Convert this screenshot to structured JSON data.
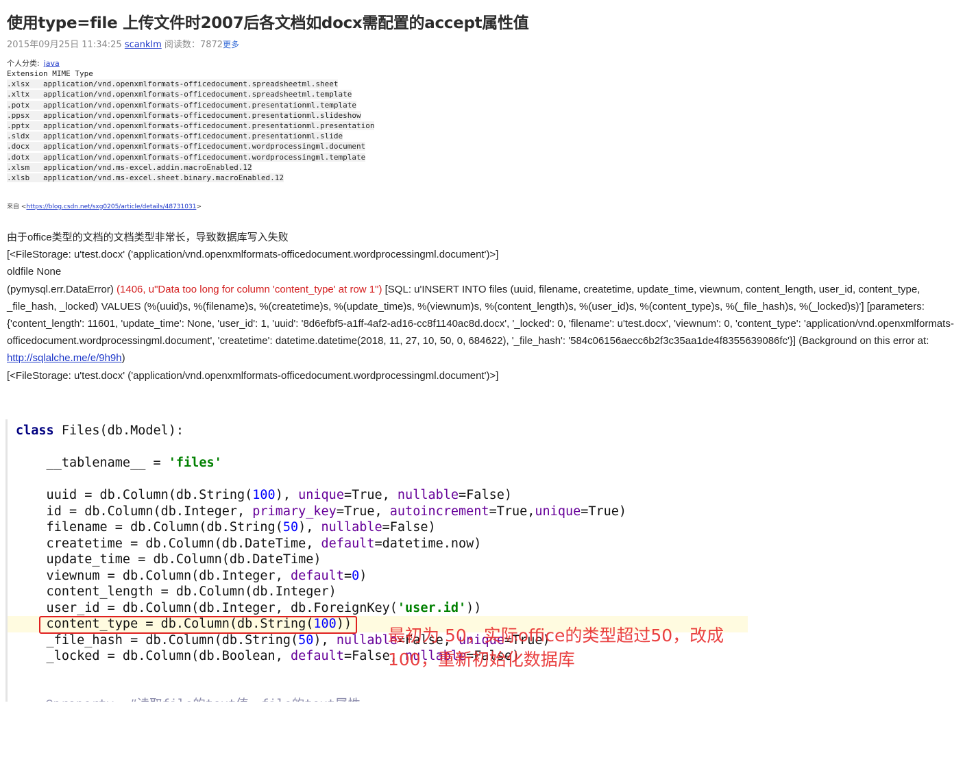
{
  "article": {
    "title": "使用type=file 上传文件时2007后各文档如docx需配置的accept属性值",
    "date": "2015年09月25日 11:34:25",
    "author": "scanklm",
    "reads_label": "阅读数：",
    "reads": "7872",
    "more": "更多",
    "category_label": "个人分类:",
    "category": "java"
  },
  "mime_table": {
    "header": "Extension MIME Type",
    "rows": [
      {
        "ext": ".xlsx",
        "type": "application/vnd.openxmlformats-officedocument.spreadsheetml.sheet"
      },
      {
        "ext": ".xltx",
        "type": "application/vnd.openxmlformats-officedocument.spreadsheetml.template"
      },
      {
        "ext": ".potx",
        "type": "application/vnd.openxmlformats-officedocument.presentationml.template"
      },
      {
        "ext": ".ppsx",
        "type": "application/vnd.openxmlformats-officedocument.presentationml.slideshow"
      },
      {
        "ext": ".pptx",
        "type": "application/vnd.openxmlformats-officedocument.presentationml.presentation"
      },
      {
        "ext": ".sldx",
        "type": "application/vnd.openxmlformats-officedocument.presentationml.slide"
      },
      {
        "ext": ".docx",
        "type": "application/vnd.openxmlformats-officedocument.wordprocessingml.document"
      },
      {
        "ext": ".dotx",
        "type": "application/vnd.openxmlformats-officedocument.wordprocessingml.template"
      },
      {
        "ext": ".xlsm",
        "type": "application/vnd.ms-excel.addin.macroEnabled.12"
      },
      {
        "ext": ".xlsb",
        "type": "application/vnd.ms-excel.sheet.binary.macroEnabled.12"
      }
    ]
  },
  "source": {
    "prefix": "来自 <",
    "url": "https://blog.csdn.net/sxg0205/article/details/48731031",
    "suffix": ">"
  },
  "log": {
    "intro": "由于office类型的文档的文档类型非常长，导致数据库写入失败",
    "filestorage_1": "[<FileStorage: u'test.docx' ('application/vnd.openxmlformats-officedocument.wordprocessingml.document')>]",
    "oldfile": "oldfile None",
    "error_prefix": "(pymysql.err.DataError) ",
    "error_red": "(1406, u\"Data too long for column 'content_type' at row 1\")",
    "error_rest": " [SQL: u'INSERT INTO files (uuid, filename, createtime, update_time, viewnum, content_length, user_id, content_type, _file_hash, _locked) VALUES (%(uuid)s, %(filename)s, %(createtime)s, %(update_time)s, %(viewnum)s, %(content_length)s, %(user_id)s, %(content_type)s, %(_file_hash)s, %(_locked)s)'] [parameters: {'content_length': 11601, 'update_time': None, 'user_id': 1, 'uuid': '8d6efbf5-a1ff-4af2-ad16-cc8f1140ac8d.docx', '_locked': 0, 'filename': u'test.docx', 'viewnum': 0, 'content_type': 'application/vnd.openxmlformats-officedocument.wordprocessingml.document', 'createtime': datetime.datetime(2018, 11, 27, 10, 50, 0, 684622), '_file_hash': '584c06156aecc6b2f3c35aa1de4f8355639086fc'}] (Background on this error at: ",
    "error_link": "http://sqlalche.me/e/9h9h",
    "error_close": ")",
    "filestorage_2": "[<FileStorage: u'test.docx' ('application/vnd.openxmlformats-officedocument.wordprocessingml.document')>]"
  },
  "code": {
    "class_kw": "class",
    "class_rest": " Files(db.Model):",
    "tablename_pre": "    __tablename__ = ",
    "tablename_val": "'files'",
    "uuid": {
      "a": "    uuid = db.Column(db.String(",
      "n": "100",
      "b": "), ",
      "k1": "unique",
      "c": "=True, ",
      "k2": "nullable",
      "d": "=False)"
    },
    "id": {
      "a": "    id = db.Column(db.Integer, ",
      "k1": "primary_key",
      "b": "=True, ",
      "k2": "autoincrement",
      "c": "=True,",
      "k3": "unique",
      "d": "=True)"
    },
    "filename": {
      "a": "    filename = db.Column(db.String(",
      "n": "50",
      "b": "), ",
      "k1": "nullable",
      "c": "=False)"
    },
    "createtime": {
      "a": "    createtime = db.Column(db.DateTime, ",
      "k1": "default",
      "b": "=datetime.now)"
    },
    "update_time": "    update_time = db.Column(db.DateTime)",
    "viewnum": {
      "a": "    viewnum = db.Column(db.Integer, ",
      "k1": "default",
      "b": "=",
      "n": "0",
      "c": ")"
    },
    "content_length": "    content_length = db.Column(db.Integer)",
    "user_id": {
      "a": "    user_id = db.Column(db.Integer, db.ForeignKey(",
      "s": "'user.id'",
      "b": "))"
    },
    "content_type": {
      "a": "    content_type = db.Column(db.String(",
      "n": "100",
      "b": "))"
    },
    "file_hash": {
      "a": "    _file_hash = db.Column(db.String(",
      "n": "50",
      "b": "), ",
      "k1": "nullable",
      "c": "=False, ",
      "k2": "unique",
      "d": "=True)"
    },
    "locked": {
      "a": "    _locked = db.Column(db.Boolean, ",
      "k1": "default",
      "b": "=False, ",
      "k2": "nullable",
      "c": "=False)"
    },
    "cutoff": "@property  #读取file的text值，file的text属性"
  },
  "annotation": {
    "line1": "最初为 50，实际office的类型超过50，改成",
    "line2": "100，重新初始化数据库"
  },
  "colors": {
    "link": "#1a35c8",
    "error_red": "#d42020",
    "annotation_red": "#e83030",
    "keyword": "#000080",
    "string": "#008000",
    "number": "#0000ff",
    "kwarg": "#660099"
  }
}
